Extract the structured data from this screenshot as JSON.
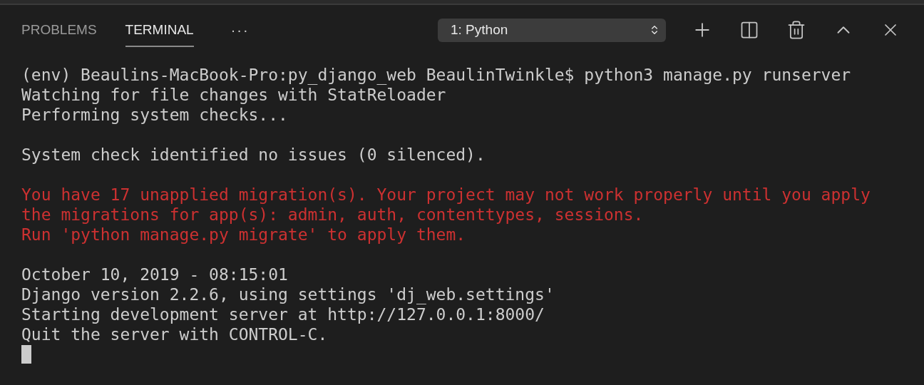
{
  "tabs": [
    {
      "label": "PROBLEMS",
      "selected": false
    },
    {
      "label": "TERMINAL",
      "selected": true
    }
  ],
  "more_menu": {
    "label": "···"
  },
  "terminal_select": {
    "value": "1: Python"
  },
  "terminal": {
    "lines": [
      {
        "kind": "normal",
        "text": "(env) Beaulins-MacBook-Pro:py_django_web BeaulinTwinkle$ python3 manage.py runserver"
      },
      {
        "kind": "normal",
        "text": "Watching for file changes with StatReloader"
      },
      {
        "kind": "normal",
        "text": "Performing system checks..."
      },
      {
        "kind": "blank"
      },
      {
        "kind": "normal",
        "text": "System check identified no issues (0 silenced)."
      },
      {
        "kind": "blank"
      },
      {
        "kind": "error",
        "text": "You have 17 unapplied migration(s). Your project may not work properly until you apply"
      },
      {
        "kind": "error",
        "text": "the migrations for app(s): admin, auth, contenttypes, sessions."
      },
      {
        "kind": "error",
        "text": "Run 'python manage.py migrate' to apply them."
      },
      {
        "kind": "blank"
      },
      {
        "kind": "normal",
        "text": "October 10, 2019 - 08:15:01"
      },
      {
        "kind": "normal",
        "text": "Django version 2.2.6, using settings 'dj_web.settings'"
      },
      {
        "kind": "normal",
        "text": "Starting development server at http://127.0.0.1:8000/"
      },
      {
        "kind": "normal",
        "text": "Quit the server with CONTROL-C."
      }
    ],
    "cursor_visible": true
  }
}
